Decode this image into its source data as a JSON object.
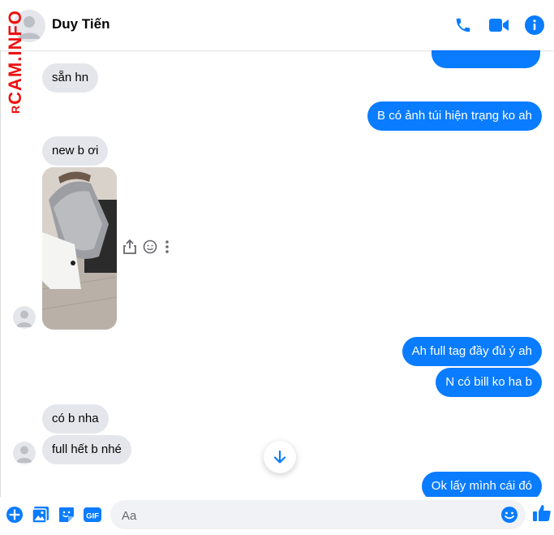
{
  "watermark": {
    "top": "R",
    "main": "CAM.INFO"
  },
  "header": {
    "contact_name": "Duy Tiến"
  },
  "messages": {
    "m1": "sẵn hn",
    "m2": "B có ảnh túi hiện trạng ko ah",
    "m3": "new b ơi",
    "m4": "Ah full tag đầy đủ ý ah",
    "m5": "N có bill ko ha b",
    "m6": "có b nha",
    "m7": "full hết b nhé",
    "m8": "Ok lấy mình cái đó"
  },
  "composer": {
    "placeholder": "Aa"
  },
  "colors": {
    "accent": "#0a7cff",
    "incoming_bubble": "#e4e6eb"
  },
  "icons": [
    "phone-icon",
    "video-icon",
    "info-icon",
    "share-icon",
    "emoji-react-icon",
    "more-icon",
    "scroll-down-icon",
    "plus-icon",
    "image-icon",
    "sticker-icon",
    "gif-icon",
    "emoji-icon",
    "like-icon"
  ]
}
